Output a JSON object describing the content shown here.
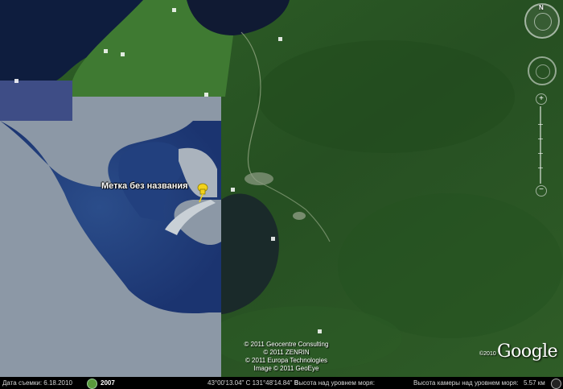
{
  "placemark": {
    "label": "Метка без названия",
    "icon": "yellow-pushpin-icon"
  },
  "copyright": [
    "© 2011 Geocentre Consulting",
    "© 2011 ZENRIN",
    "© 2011 Europa Technologies",
    "Image © 2011 GeoEye"
  ],
  "logo": {
    "text": "Google",
    "year": "©2010"
  },
  "navigation": {
    "north_label": "N"
  },
  "status_bar": {
    "imagery_date_label": "Дата съемки: 6.18.2010",
    "historical_year": "2007",
    "coordinates": "43°00'13.04\" С  131°48'14.84\" В",
    "elevation_label": "Высота над уровнем моря:",
    "eye_alt_label": "Высота камеры над уровнем моря:",
    "eye_alt_value": "5.57 км"
  },
  "colors": {
    "forest": "#2a5a24",
    "water": "#233f7a",
    "pin": "#f2d21a"
  }
}
